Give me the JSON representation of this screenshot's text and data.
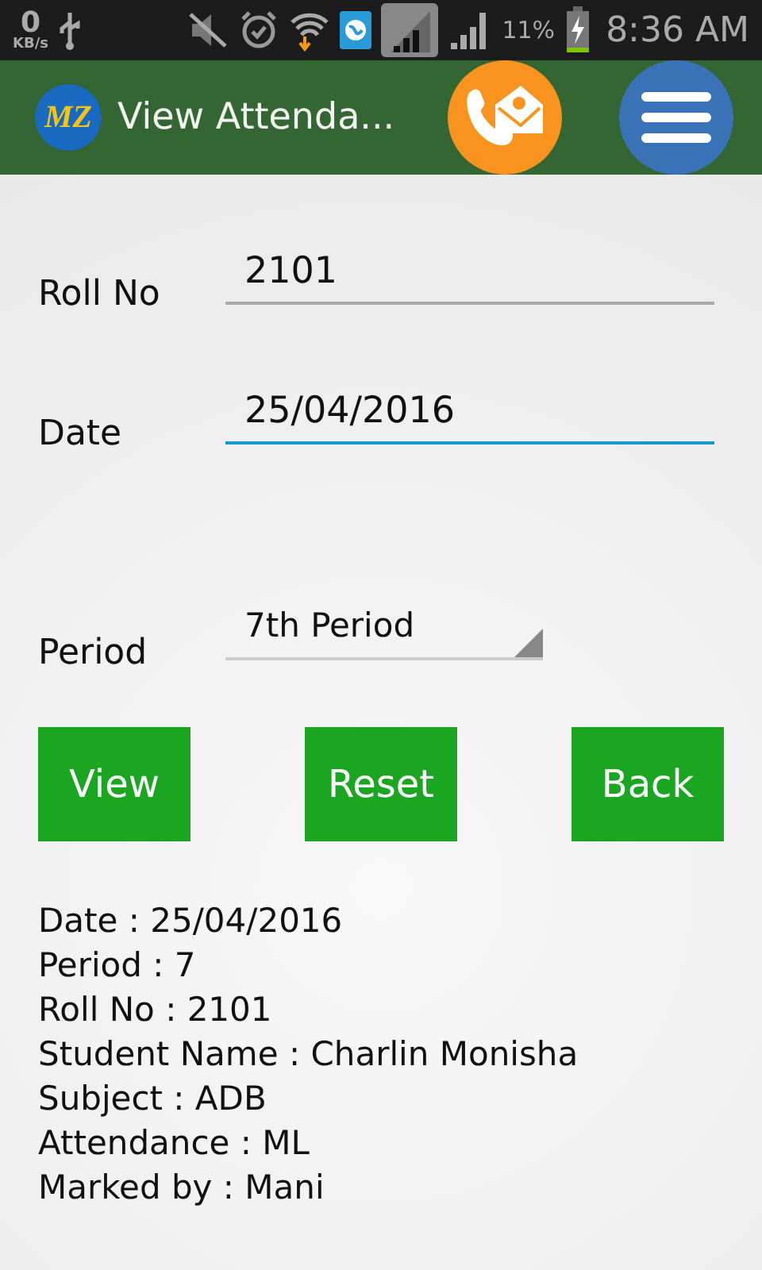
{
  "status_bar": {
    "speed": "0",
    "speed_unit": "KB/s",
    "battery_percent": "11%",
    "time": "8:36 AM"
  },
  "app_bar": {
    "logo": "MZ",
    "title": "View Attenda..."
  },
  "fields": [
    {
      "label": "Roll No",
      "value": "2101",
      "focused": false
    },
    {
      "label": "Date",
      "value": "25/04/2016",
      "focused": true
    }
  ],
  "period": {
    "label": "Period",
    "value": "7th Period"
  },
  "buttons": [
    "View",
    "Reset",
    "Back"
  ],
  "result_lines": [
    "Date : 25/04/2016",
    "Period : 7",
    "Roll No : 2101",
    "Student Name : Charlin Monisha",
    "Subject : ADB",
    "Attendance : ML",
    "Marked by : Mani"
  ]
}
